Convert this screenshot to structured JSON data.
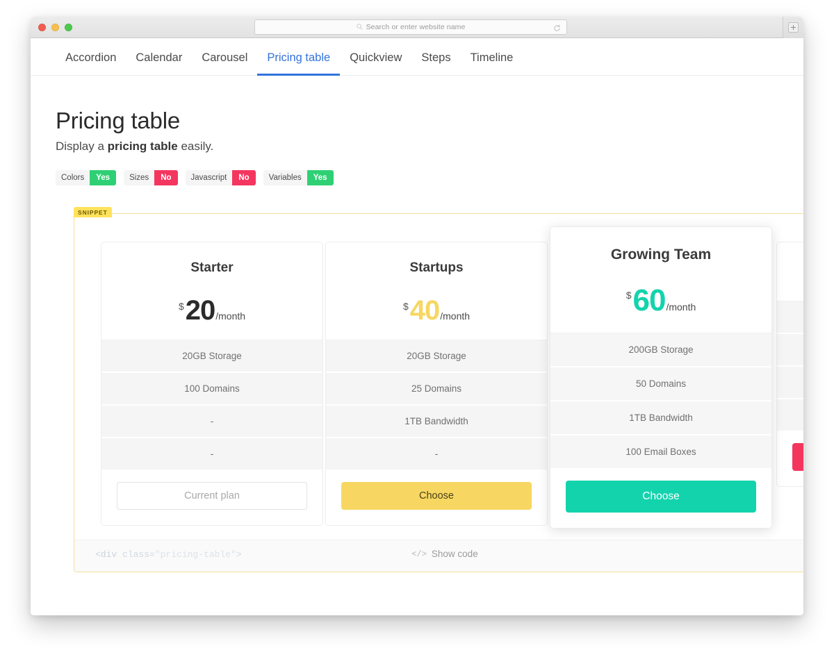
{
  "browser": {
    "address_placeholder": "Search or enter website name",
    "search_icon": "search-icon",
    "reload_icon": "reload-icon",
    "newtab_label": "+"
  },
  "nav": {
    "items": [
      {
        "label": "Accordion",
        "active": false
      },
      {
        "label": "Calendar",
        "active": false
      },
      {
        "label": "Carousel",
        "active": false
      },
      {
        "label": "Pricing table",
        "active": true
      },
      {
        "label": "Quickview",
        "active": false
      },
      {
        "label": "Steps",
        "active": false
      },
      {
        "label": "Timeline",
        "active": false
      }
    ]
  },
  "intro": {
    "title": "Pricing table",
    "subtitle_before": "Display a ",
    "subtitle_strong": "pricing table",
    "subtitle_after": " easily."
  },
  "tags": [
    {
      "key": "Colors",
      "value": "Yes",
      "color": "#2fd074"
    },
    {
      "key": "Sizes",
      "value": "No",
      "color": "#f4365f"
    },
    {
      "key": "Javascript",
      "value": "No",
      "color": "#f4365f"
    },
    {
      "key": "Variables",
      "value": "Yes",
      "color": "#2fd074"
    }
  ],
  "snippet": {
    "label": "SNIPPET",
    "border_color": "#f2e09a",
    "code_line_1_a": "<div",
    "code_line_1_b": " class=",
    "code_line_1_c": "\"pricing-table\"",
    "code_line_1_d": ">",
    "show_code_label": "Show code",
    "show_code_glyph": "</>"
  },
  "plans": [
    {
      "name": "Starter",
      "currency": "$",
      "amount": "20",
      "period": "/month",
      "amount_color": "#2b2b2b",
      "features": [
        "20GB Storage",
        "100 Domains",
        "-",
        "-"
      ],
      "cta_label": "Current plan",
      "cta_style": "outline",
      "featured": false
    },
    {
      "name": "Startups",
      "currency": "$",
      "amount": "40",
      "period": "/month",
      "amount_color": "#f7d762",
      "features": [
        "20GB Storage",
        "25 Domains",
        "1TB Bandwidth",
        "-"
      ],
      "cta_label": "Choose",
      "cta_style": "solid-yellow",
      "featured": false
    },
    {
      "name": "Growing Team",
      "currency": "$",
      "amount": "60",
      "period": "/month",
      "amount_color": "#13d3ad",
      "features": [
        "200GB Storage",
        "50 Domains",
        "1TB Bandwidth",
        "100 Email Boxes"
      ],
      "cta_label": "Choose",
      "cta_style": "solid-teal",
      "featured": true
    },
    {
      "name": "",
      "currency": "",
      "amount": "",
      "period": "",
      "amount_color": "#f4365f",
      "features": [
        "",
        "",
        "",
        ""
      ],
      "cta_label": "",
      "cta_style": "solid-red",
      "featured": false
    }
  ]
}
